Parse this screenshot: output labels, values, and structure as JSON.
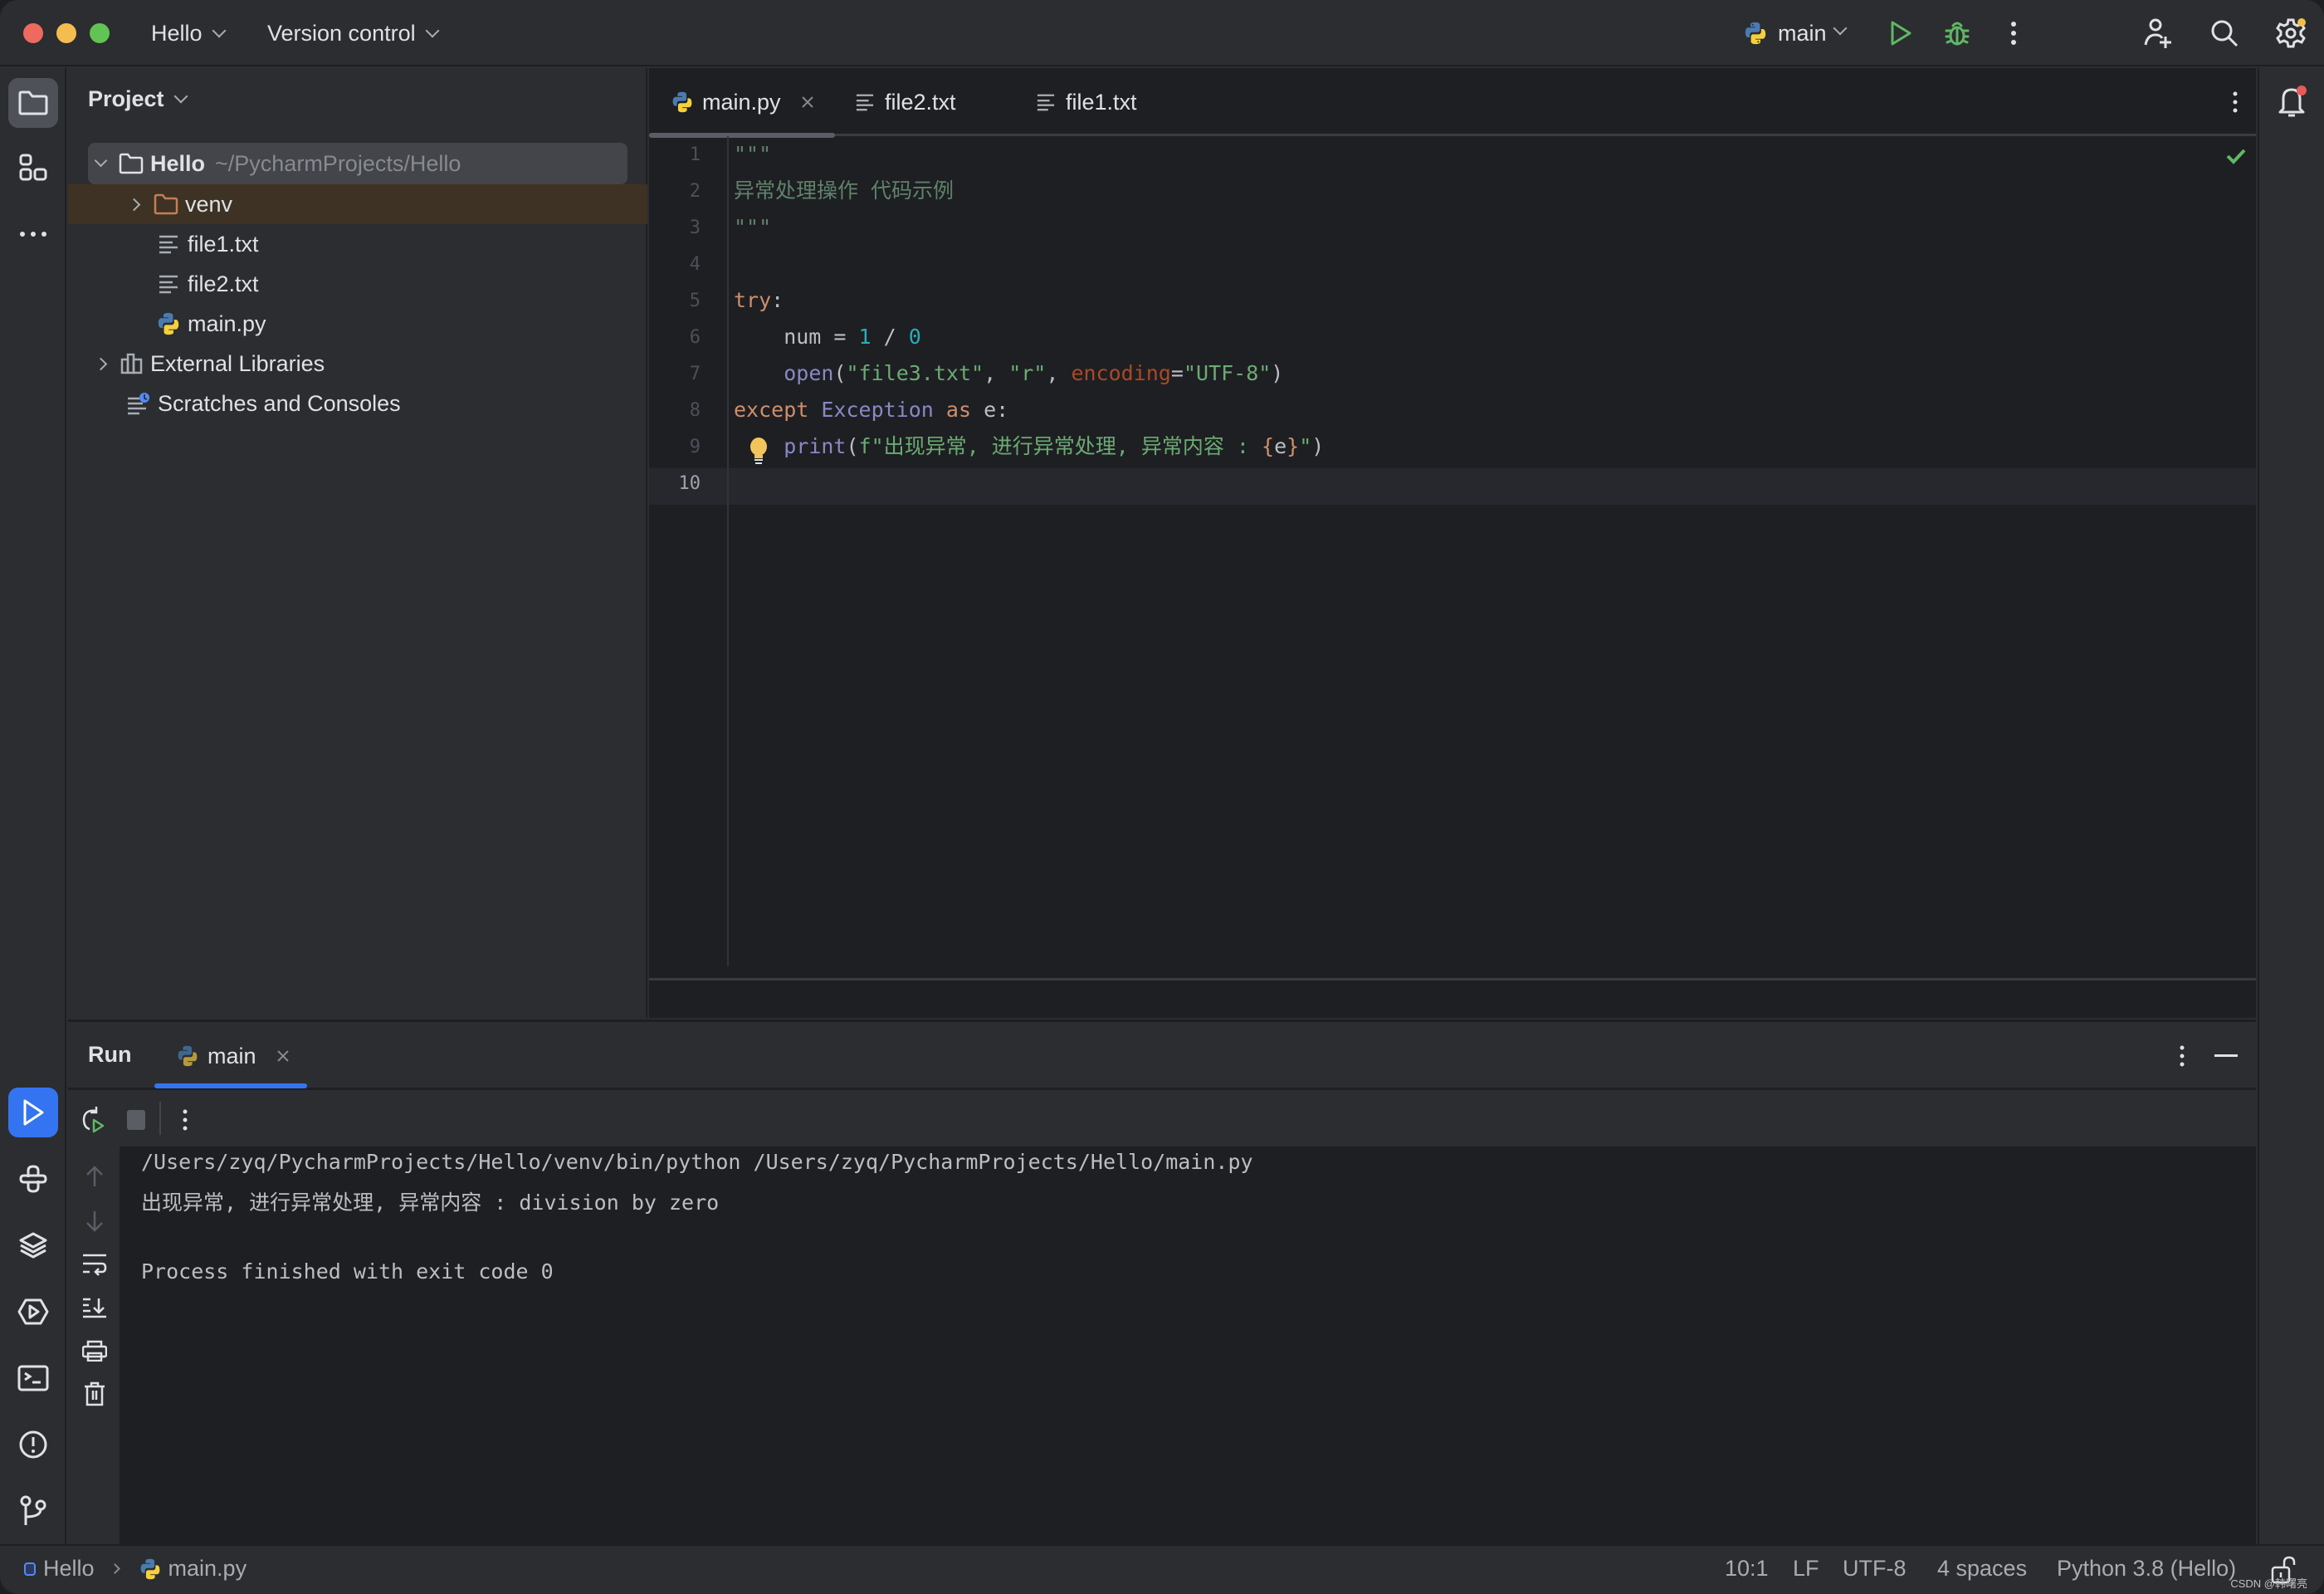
{
  "titlebar": {
    "project": "Hello",
    "vcs": "Version control",
    "run_config": "main",
    "traffic_colors": {
      "close": "#ee6a5f",
      "minimize": "#f5bd4f",
      "maximize": "#61c454"
    }
  },
  "left_toolbar": {
    "top": [
      {
        "name": "project",
        "icon": "folder-icon",
        "active": true
      },
      {
        "name": "structure",
        "icon": "structure-icon"
      },
      {
        "name": "more",
        "icon": "more-horizontal-icon"
      }
    ],
    "bottom": [
      {
        "name": "run",
        "icon": "run-icon",
        "active": true
      },
      {
        "name": "python-console",
        "icon": "python-icon"
      },
      {
        "name": "python-packages",
        "icon": "layers-icon"
      },
      {
        "name": "services",
        "icon": "services-icon"
      },
      {
        "name": "terminal",
        "icon": "terminal-icon"
      },
      {
        "name": "problems",
        "icon": "problems-icon"
      },
      {
        "name": "git",
        "icon": "git-branch-icon"
      }
    ]
  },
  "project_panel": {
    "title": "Project",
    "tree": [
      {
        "label": "Hello",
        "path": "~/PycharmProjects/Hello",
        "type": "folder",
        "expanded": true,
        "selected": true
      },
      {
        "label": "venv",
        "type": "excluded-folder",
        "expanded": false
      },
      {
        "label": "file1.txt",
        "type": "text"
      },
      {
        "label": "file2.txt",
        "type": "text"
      },
      {
        "label": "main.py",
        "type": "python"
      },
      {
        "label": "External Libraries",
        "type": "libraries",
        "expanded": false
      },
      {
        "label": "Scratches and Consoles",
        "type": "scratches"
      }
    ]
  },
  "editor": {
    "tabs": [
      {
        "label": "main.py",
        "type": "python",
        "active": true,
        "closable": true
      },
      {
        "label": "file2.txt",
        "type": "text"
      },
      {
        "label": "file1.txt",
        "type": "text"
      }
    ],
    "line_numbers": [
      "1",
      "2",
      "3",
      "4",
      "5",
      "6",
      "7",
      "8",
      "9",
      "10"
    ],
    "current_line": "10",
    "inspection_status": "ok",
    "code": {
      "l1": "\"\"\"",
      "l2": "异常处理操作 代码示例",
      "l3": "\"\"\"",
      "l5_kw": "try",
      "l5_colon": ":",
      "l6_a": "    num = ",
      "l6_n1": "1",
      "l6_op": " / ",
      "l6_n2": "0",
      "l7_fn": "open",
      "l7_p1": "(",
      "l7_s1": "\"file3.txt\"",
      "l7_c1": ", ",
      "l7_s2": "\"r\"",
      "l7_c2": ", ",
      "l7_param": "encoding",
      "l7_eq": "=",
      "l7_s3": "\"UTF-8\"",
      "l7_p2": ")",
      "l8_kw1": "except",
      "l8_cls": "Exception",
      "l8_kw2": "as",
      "l8_rest": " e:",
      "l9_fn": "print",
      "l9_p1": "(",
      "l9_s1": "f\"出现异常, 进行异常处理, 异常内容 : ",
      "l9_b1": "{",
      "l9_var": "e",
      "l9_b2": "}",
      "l9_s2": "\"",
      "l9_p2": ")"
    }
  },
  "run_panel": {
    "title": "Run",
    "tab": "main",
    "console": [
      "/Users/zyq/PycharmProjects/Hello/venv/bin/python /Users/zyq/PycharmProjects/Hello/main.py",
      "出现异常, 进行异常处理, 异常内容 : division by zero",
      "",
      "Process finished with exit code 0"
    ]
  },
  "status_bar": {
    "breadcrumb": [
      "Hello",
      "main.py"
    ],
    "position": "10:1",
    "line_separator": "LF",
    "encoding": "UTF-8",
    "indent": "4 spaces",
    "interpreter": "Python 3.8 (Hello)",
    "watermark": "CSDN @韩曙亮"
  }
}
